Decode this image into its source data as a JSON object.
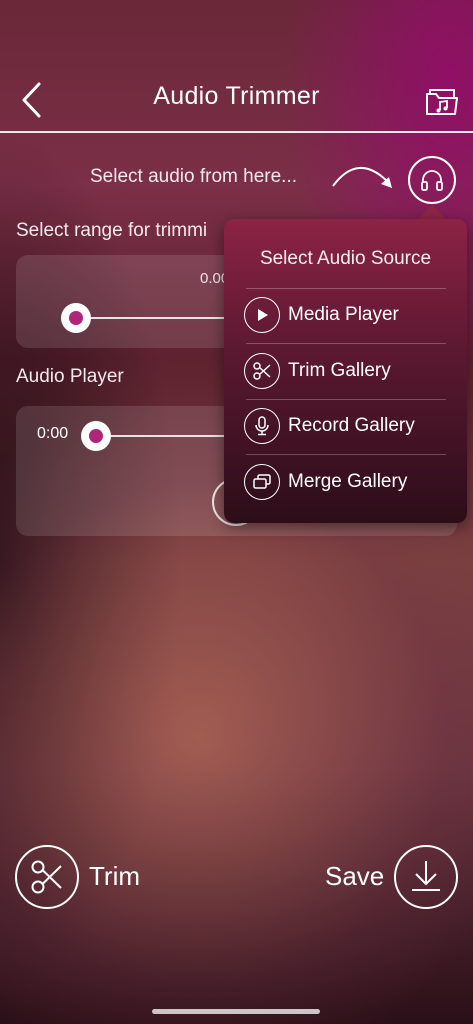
{
  "header": {
    "title": "Audio Trimmer",
    "back_icon": "chevron-left-icon",
    "folder_icon": "music-folder-icon"
  },
  "source": {
    "hint": "Select audio from here...",
    "button_icon": "headphones-icon"
  },
  "trim": {
    "label": "Select range for trimmi",
    "time_text": "0.00",
    "range_start_fraction": 0.0
  },
  "player": {
    "label": "Audio Player",
    "current_time": "0:00",
    "progress_fraction": 0.0
  },
  "source_menu": {
    "title": "Select Audio Source",
    "items": [
      {
        "label": "Media Player",
        "icon": "play-icon"
      },
      {
        "label": "Trim Gallery",
        "icon": "scissors-icon"
      },
      {
        "label": "Record Gallery",
        "icon": "microphone-icon"
      },
      {
        "label": "Merge Gallery",
        "icon": "merge-icon"
      }
    ]
  },
  "actions": {
    "trim_label": "Trim",
    "save_label": "Save"
  },
  "colors": {
    "accent": "#b0247a",
    "menu_top": "#8c2345",
    "menu_bottom": "#2b0d18"
  }
}
